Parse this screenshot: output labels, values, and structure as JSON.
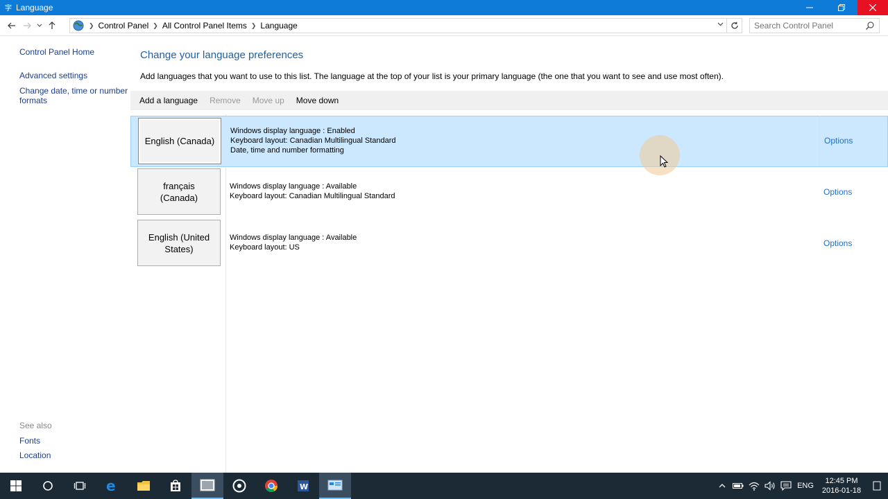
{
  "window": {
    "title": "Language",
    "minimize_icon": "minimize-icon",
    "restore_icon": "restore-icon",
    "close_icon": "close-icon"
  },
  "address": {
    "breadcrumbs": [
      "Control Panel",
      "All Control Panel Items",
      "Language"
    ],
    "search_placeholder": "Search Control Panel"
  },
  "sidebar": {
    "home": "Control Panel Home",
    "advanced": "Advanced settings",
    "date_time_line1": "Change date, time or number",
    "date_time_line2": "formats",
    "see_also": "See also",
    "fonts": "Fonts",
    "location": "Location"
  },
  "main": {
    "title": "Change your language preferences",
    "description": "Add languages that you want to use to this list. The language at the top of your list is your primary language (the one that you want to see and use most often).",
    "toolbar": {
      "add": "Add a language",
      "remove": "Remove",
      "move_up": "Move up",
      "move_down": "Move down"
    },
    "languages": [
      {
        "name": "English (Canada)",
        "line1": "Windows display language : Enabled",
        "line2": "Keyboard layout: Canadian Multilingual Standard",
        "line3": "Date, time and number formatting",
        "options": "Options",
        "selected": true
      },
      {
        "name": "français (Canada)",
        "line1": "Windows display language : Available",
        "line2": "Keyboard layout: Canadian Multilingual Standard",
        "line3": "",
        "options": "Options",
        "selected": false
      },
      {
        "name": "English (United States)",
        "line1": "Windows display language : Available",
        "line2": "Keyboard layout: US",
        "line3": "",
        "options": "Options",
        "selected": false
      }
    ]
  },
  "taskbar": {
    "apps": [
      "start-icon",
      "cortana-icon",
      "task-view-icon",
      "edge-icon",
      "file-explorer-icon",
      "store-icon",
      "photos-icon",
      "groove-icon",
      "chrome-icon",
      "word-icon",
      "control-panel-icon"
    ],
    "input_language": "ENG",
    "time": "12:45 PM",
    "date": "2016-01-18"
  },
  "colors": {
    "titlebar": "#0f7bd8",
    "close_button": "#e81123",
    "link": "#1a3e8c",
    "heading": "#1e5fa5",
    "selection": "#cce8ff",
    "taskbar": "#1c2a36"
  }
}
